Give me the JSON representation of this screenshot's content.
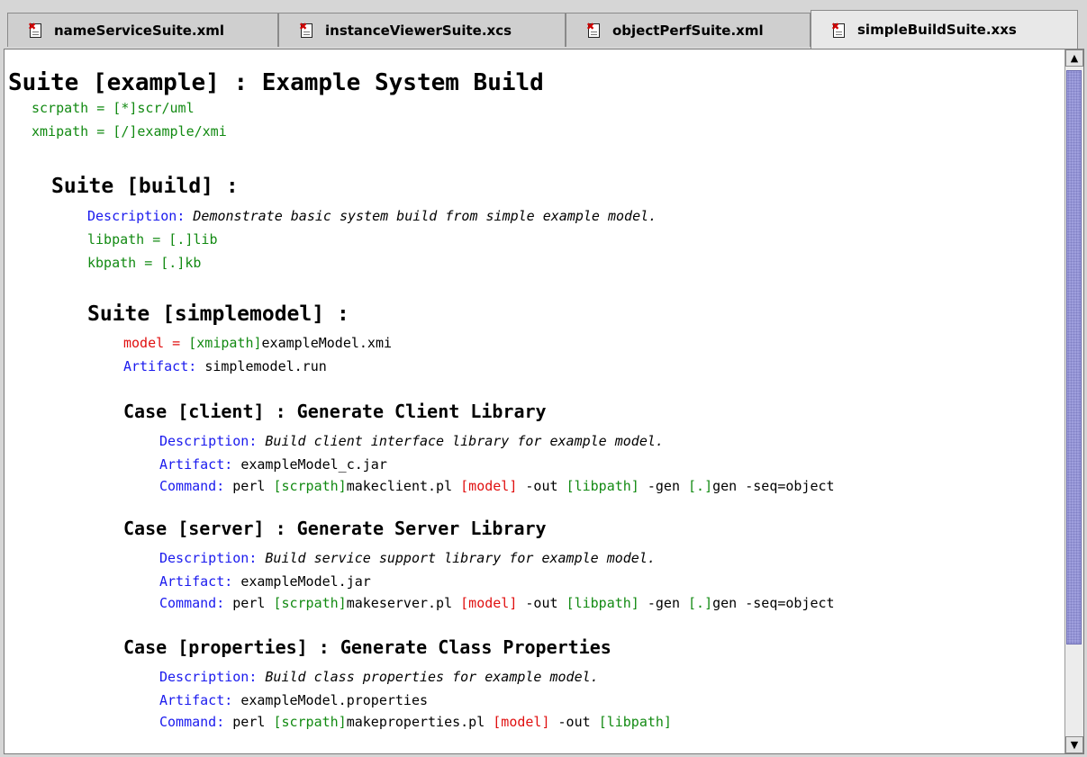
{
  "tabs": [
    {
      "label": "nameServiceSuite.xml",
      "active": false
    },
    {
      "label": "instanceViewerSuite.xcs",
      "active": false
    },
    {
      "label": "objectPerfSuite.xml",
      "active": false
    },
    {
      "label": "simpleBuildSuite.xxs",
      "active": true
    }
  ],
  "icons": {
    "tab_file": "xml-document-icon",
    "scroll_up": "arrow-up-icon",
    "scroll_down": "arrow-down-icon"
  },
  "colors": {
    "param": "#128a12",
    "keyword": "#1a1aee",
    "override": "#e01010",
    "thumb": "#9f9fdd"
  },
  "doc": {
    "suite_example": {
      "heading": "Suite [example] : Example System Build",
      "scrpath": "scrpath = [*]scr/uml",
      "xmipath": "xmipath = [/]example/xmi"
    },
    "suite_build": {
      "heading": "Suite [build] :",
      "desc_label": "Description:",
      "desc_text": "Demonstrate basic system build from simple example model.",
      "libpath": "libpath = [.]lib",
      "kbpath": "kbpath = [.]kb"
    },
    "suite_simplemodel": {
      "heading": "Suite [simplemodel] :",
      "model_key": "model = ",
      "model_ref": "[xmipath]",
      "model_val": "exampleModel.xmi",
      "artifact_label": "Artifact:",
      "artifact_val": "simplemodel.run"
    },
    "case_client": {
      "heading": "Case [client] : Generate Client Library",
      "desc_label": "Description:",
      "desc_text": "Build client interface library for example model.",
      "artifact_label": "Artifact:",
      "artifact_val": "exampleModel_c.jar",
      "command_label": "Command:",
      "cmd": [
        "perl ",
        "[scrpath]",
        "makeclient.pl ",
        "[model]",
        " -out ",
        "[libpath]",
        " -gen ",
        "[.]",
        "gen -seq=object"
      ]
    },
    "case_server": {
      "heading": "Case [server] : Generate Server Library",
      "desc_label": "Description:",
      "desc_text": "Build service support library for example model.",
      "artifact_label": "Artifact:",
      "artifact_val": "exampleModel.jar",
      "command_label": "Command:",
      "cmd": [
        "perl ",
        "[scrpath]",
        "makeserver.pl ",
        "[model]",
        " -out ",
        "[libpath]",
        " -gen ",
        "[.]",
        "gen -seq=object"
      ]
    },
    "case_properties": {
      "heading": "Case [properties] : Generate Class Properties",
      "desc_label": "Description:",
      "desc_text": "Build class properties for example model.",
      "artifact_label": "Artifact:",
      "artifact_val": "exampleModel.properties",
      "command_label": "Command:",
      "cmd": [
        "perl ",
        "[scrpath]",
        "makeproperties.pl ",
        "[model]",
        " -out ",
        "[libpath]"
      ]
    }
  }
}
